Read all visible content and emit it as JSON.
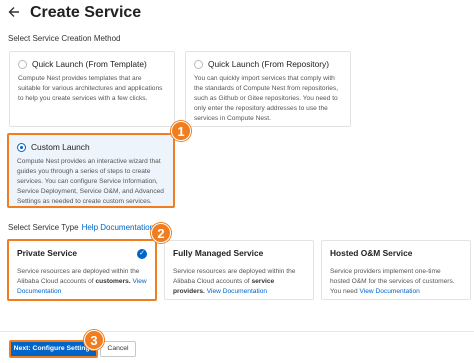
{
  "header": {
    "back_icon": "arrow-left-icon",
    "title": "Create Service"
  },
  "creation_method": {
    "label": "Select Service Creation Method",
    "options": [
      {
        "title": "Quick Launch (From Template)",
        "description": "Compute Nest provides templates that are suitable for various architectures and applications to help you create services with a few clicks.",
        "selected": false
      },
      {
        "title": "Quick Launch (From Repository)",
        "description": "You can quickly import services that comply with the standards of Compute Nest from repositories, such as Github or Gitee repositories. You need to only enter the repository addresses to use the services in Compute Nest.",
        "selected": false
      },
      {
        "title": "Custom Launch",
        "description": "Compute Nest provides an interactive wizard that guides you through a series of steps to create services. You can configure Service Information, Service Deployment, Service O&M, and Advanced Settings as needed to create custom services.",
        "selected": true
      }
    ]
  },
  "service_type": {
    "label": "Select Service Type",
    "help_link": "Help Documentation",
    "options": [
      {
        "title": "Private Service",
        "desc_before": "Service resources are deployed within the Alibaba Cloud accounts of",
        "desc_bold": "customers.",
        "link": "View Documentation",
        "selected": true
      },
      {
        "title": "Fully Managed Service",
        "desc_before": "Service resources are deployed within the Alibaba Cloud accounts of",
        "desc_bold": "service providers.",
        "link": "View Documentation",
        "selected": false
      },
      {
        "title": "Hosted O&M Service",
        "desc_before": "Service providers implement one-time hosted O&M for the services of customers. You need",
        "desc_bold": "",
        "link": "View Documentation",
        "selected": false
      }
    ]
  },
  "annotations": {
    "step1": "1",
    "step2": "2",
    "step3": "3",
    "color": "#f07d20"
  },
  "footer": {
    "next_label": "Next: Configure Settings",
    "cancel_label": "Cancel"
  },
  "colors": {
    "primary": "#0064c8",
    "highlight": "#f07d20"
  }
}
